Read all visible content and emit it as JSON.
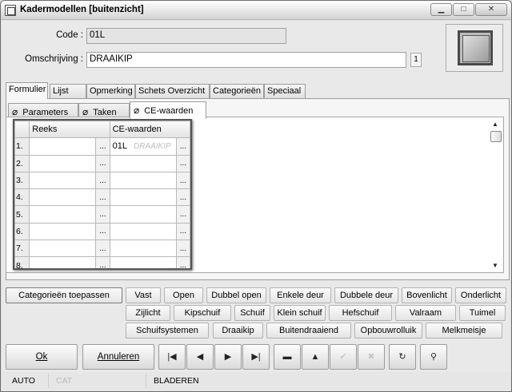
{
  "window": {
    "title": "Kadermodellen [buitenzicht]",
    "min_icon": "minimize-icon",
    "max_icon": "maximize-icon",
    "close_icon": "close-icon"
  },
  "form": {
    "code_label": "Code :",
    "code_value": "01L",
    "omschrijving_label": "Omschrijving :",
    "omschrijving_value": "DRAAIKIP",
    "count": "1"
  },
  "tabs": [
    "Formulier",
    "Lijst",
    "Opmerking",
    "Schets Overzicht",
    "Categorieën",
    "Speciaal"
  ],
  "subtabs": [
    "Parameters",
    "Taken",
    "CE-waarden"
  ],
  "grid": {
    "headers": [
      "Reeks",
      "CE-waarden"
    ],
    "rows": [
      {
        "n": "1.",
        "reeks": "",
        "ce": "01L",
        "ce_watermark": "DRAAIKIP"
      },
      {
        "n": "2.",
        "reeks": "",
        "ce": ""
      },
      {
        "n": "3.",
        "reeks": "",
        "ce": ""
      },
      {
        "n": "4.",
        "reeks": "",
        "ce": ""
      },
      {
        "n": "5.",
        "reeks": "",
        "ce": ""
      },
      {
        "n": "6.",
        "reeks": "",
        "ce": ""
      },
      {
        "n": "7.",
        "reeks": "",
        "ce": ""
      },
      {
        "n": "8.",
        "reeks": "",
        "ce": ""
      }
    ],
    "ellipsis": "..."
  },
  "category_buttons": {
    "apply": "Categorieën toepassen",
    "row1": [
      "Vast",
      "Open",
      "Dubbel open",
      "Enkele deur",
      "Dubbele deur",
      "Bovenlicht",
      "Onderlicht"
    ],
    "row2": [
      "Zijlicht",
      "Kipschuif",
      "Schuif",
      "Klein schuif",
      "Hefschuif",
      "Valraam",
      "Tuimel"
    ],
    "row3": [
      "Schuifsystemen",
      "Draaikip",
      "Buitendraaiend",
      "Opbouwrolluik",
      "Melkmeisje"
    ]
  },
  "actions": {
    "ok": "Ok",
    "cancel": "Annuleren"
  },
  "nav_icons": [
    "first-record-icon",
    "prev-record-icon",
    "next-record-icon",
    "last-record-icon",
    "delete-icon",
    "insert-icon",
    "confirm-icon",
    "cancel-edit-icon",
    "refresh-icon",
    "find-icon"
  ],
  "status": {
    "mode1": "AUTO",
    "mode2": "CAT",
    "mode3": "BLADEREN"
  }
}
